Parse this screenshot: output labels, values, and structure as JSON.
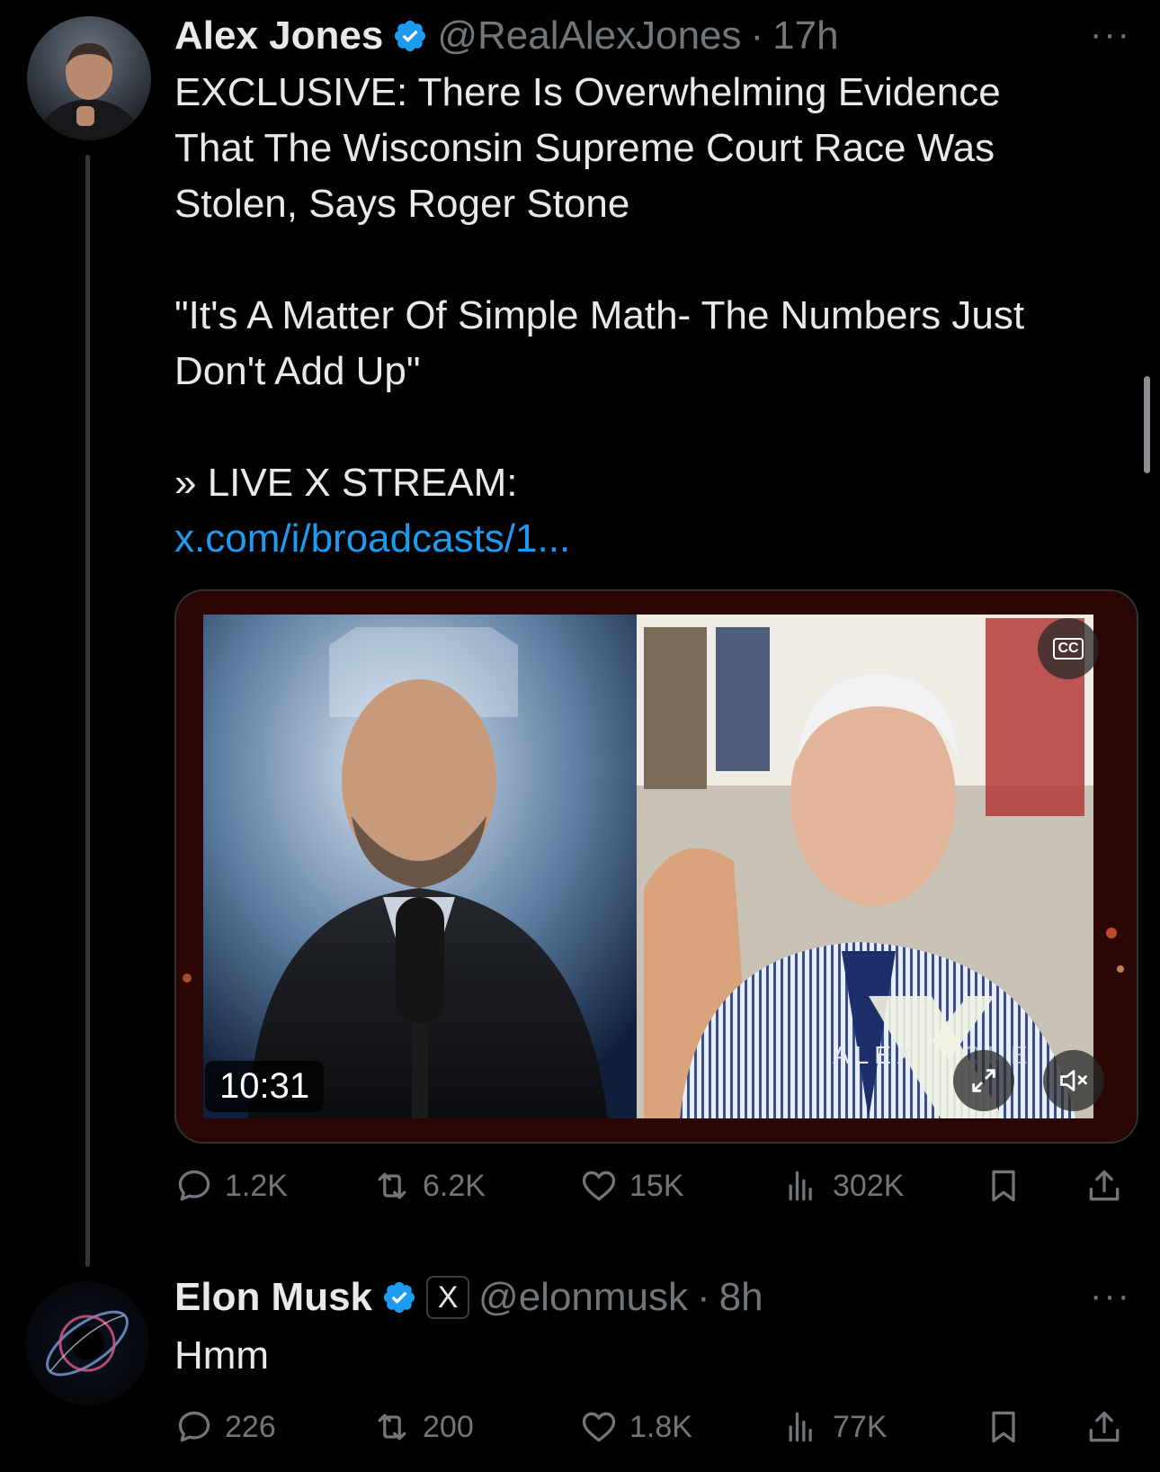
{
  "tweet": {
    "author_name": "Alex Jones",
    "handle": "@RealAlexJones",
    "separator": "·",
    "time": "17h",
    "more": "···",
    "text_lines": [
      "EXCLUSIVE: There Is Overwhelming Evidence",
      "That The Wisconsin Supreme Court Race Was",
      "Stolen, Says Roger Stone"
    ],
    "quote_lines": [
      "\"It's A Matter Of Simple Math- The Numbers Just",
      "Don't Add Up\""
    ],
    "stream_label": "» LIVE X STREAM:",
    "link": "x.com/i/broadcasts/1...",
    "media": {
      "duration": "10:31",
      "cc_label": "CC",
      "watermark_text": "ALEX",
      "watermark_tail": "ONE"
    },
    "stats": {
      "replies": "1.2K",
      "reposts": "6.2K",
      "likes": "15K",
      "views": "302K"
    }
  },
  "reply": {
    "author_name": "Elon Musk",
    "affiliate_badge": "X",
    "handle": "@elonmusk",
    "separator": "·",
    "time": "8h",
    "more": "···",
    "text": "Hmm",
    "stats": {
      "replies": "226",
      "reposts": "200",
      "likes": "1.8K",
      "views": "77K"
    }
  },
  "colors": {
    "background": "#000000",
    "text": "#e7e9ea",
    "secondary": "#71767b",
    "link": "#1d9bf0",
    "verified": "#1d9bf0"
  }
}
